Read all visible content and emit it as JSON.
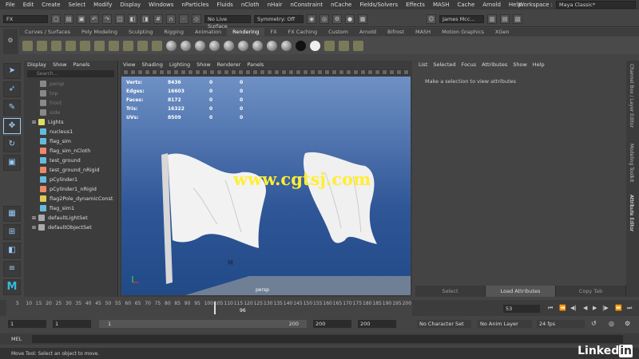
{
  "menubar": {
    "items": [
      "File",
      "Edit",
      "Create",
      "Select",
      "Modify",
      "Display",
      "Windows",
      "nParticles",
      "Fluids",
      "nCloth",
      "nHair",
      "nConstraint",
      "nCache",
      "Fields/Solvers",
      "Effects",
      "MASH",
      "Cache",
      "Arnold",
      "Help"
    ],
    "workspace_label": "Workspace :",
    "workspace_value": "Maya Classic*"
  },
  "toolbar": {
    "mode": "FX",
    "live_surface": "No Live Surface",
    "symmetry": "Symmetry: Off",
    "user": "James Mcc..."
  },
  "shelf": {
    "tabs": [
      "Curves / Surfaces",
      "Poly Modeling",
      "Sculpting",
      "Rigging",
      "Animation",
      "Rendering",
      "FX",
      "FX Caching",
      "Custom",
      "Arnold",
      "Bifrost",
      "MASH",
      "Motion Graphics",
      "XGen"
    ],
    "active_tab": "Rendering"
  },
  "outliner": {
    "menu": [
      "Display",
      "Show",
      "Panels"
    ],
    "search_placeholder": "Search...",
    "items": [
      {
        "label": "persp",
        "dim": true
      },
      {
        "label": "top",
        "dim": true
      },
      {
        "label": "front",
        "dim": true
      },
      {
        "label": "side",
        "dim": true
      },
      {
        "label": "Lights",
        "dim": false
      },
      {
        "label": "nucleus1",
        "dim": false
      },
      {
        "label": "flag_sim",
        "dim": false
      },
      {
        "label": "flag_sim_nCloth",
        "dim": false
      },
      {
        "label": "test_ground",
        "dim": false
      },
      {
        "label": "test_ground_nRigid",
        "dim": false
      },
      {
        "label": "pCylinder1",
        "dim": false
      },
      {
        "label": "pCylinder1_nRigid",
        "dim": false
      },
      {
        "label": "flag2Pole_dynamicConst",
        "dim": false
      },
      {
        "label": "flag_sim1",
        "dim": false
      },
      {
        "label": "defaultLightSet",
        "dim": false
      },
      {
        "label": "defaultObjectSet",
        "dim": false
      }
    ]
  },
  "viewport": {
    "menu": [
      "View",
      "Shading",
      "Lighting",
      "Show",
      "Renderer",
      "Panels"
    ],
    "camera": "persp",
    "hud": [
      {
        "label": "Verts:",
        "v1": "8436",
        "v2": "0",
        "v3": "0"
      },
      {
        "label": "Edges:",
        "v1": "16603",
        "v2": "0",
        "v3": "0"
      },
      {
        "label": "Faces:",
        "v1": "8172",
        "v2": "0",
        "v3": "0"
      },
      {
        "label": "Tris:",
        "v1": "16322",
        "v2": "0",
        "v3": "0"
      },
      {
        "label": "UVs:",
        "v1": "8509",
        "v2": "0",
        "v3": "0"
      }
    ],
    "watermark": "www.cgtsj.com"
  },
  "attribute_editor": {
    "menu": [
      "List",
      "Selected",
      "Focus",
      "Attributes",
      "Show",
      "Help"
    ],
    "message": "Make a selection to view attributes",
    "buttons": [
      "Select",
      "Load Attributes",
      "Copy Tab"
    ]
  },
  "side_tabs": [
    "Channel Box / Layer Editor",
    "Modeling Toolkit",
    "Attribute Editor"
  ],
  "timeline": {
    "ticks": [
      "5",
      "10",
      "15",
      "20",
      "25",
      "30",
      "35",
      "40",
      "45",
      "50",
      "55",
      "60",
      "65",
      "70",
      "75",
      "80",
      "85",
      "90",
      "95",
      "100",
      "105",
      "110",
      "115",
      "120",
      "125",
      "130",
      "135",
      "140",
      "145",
      "150",
      "155",
      "160",
      "165",
      "170",
      "175",
      "180",
      "185",
      "190",
      "195",
      "200"
    ],
    "current_frame": "53",
    "playhead_label": "96"
  },
  "range": {
    "start_outer": "1",
    "start_inner": "1",
    "slider_start": "1",
    "slider_end": "200",
    "end_inner": "200",
    "end_outer": "200",
    "char_set": "No Character Set",
    "anim_layer": "No Anim Layer",
    "fps": "24 fps"
  },
  "command_line": {
    "label": "MEL"
  },
  "help_line": {
    "text": "Move Tool: Select an object to move."
  },
  "branding": {
    "logo": "Linked in"
  }
}
